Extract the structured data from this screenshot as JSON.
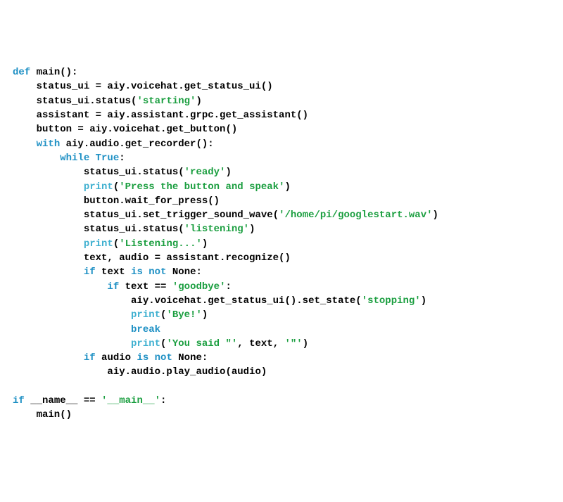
{
  "code": {
    "lines": [
      [
        {
          "t": "def ",
          "c": "kw"
        },
        {
          "t": "main():",
          "c": "plain"
        }
      ],
      [
        {
          "t": "    status_ui = aiy.voicehat.get_status_ui()",
          "c": "plain"
        }
      ],
      [
        {
          "t": "    status_ui.status(",
          "c": "plain"
        },
        {
          "t": "'starting'",
          "c": "str"
        },
        {
          "t": ")",
          "c": "plain"
        }
      ],
      [
        {
          "t": "    assistant = aiy.assistant.grpc.get_assistant()",
          "c": "plain"
        }
      ],
      [
        {
          "t": "    button = aiy.voicehat.get_button()",
          "c": "plain"
        }
      ],
      [
        {
          "t": "    ",
          "c": "plain"
        },
        {
          "t": "with",
          "c": "kw"
        },
        {
          "t": " aiy.audio.get_recorder():",
          "c": "plain"
        }
      ],
      [
        {
          "t": "        ",
          "c": "plain"
        },
        {
          "t": "while True",
          "c": "kw"
        },
        {
          "t": ":",
          "c": "plain"
        }
      ],
      [
        {
          "t": "            status_ui.status(",
          "c": "plain"
        },
        {
          "t": "'ready'",
          "c": "str"
        },
        {
          "t": ")",
          "c": "plain"
        }
      ],
      [
        {
          "t": "            ",
          "c": "plain"
        },
        {
          "t": "print",
          "c": "fn"
        },
        {
          "t": "(",
          "c": "plain"
        },
        {
          "t": "'Press the button and speak'",
          "c": "str"
        },
        {
          "t": ")",
          "c": "plain"
        }
      ],
      [
        {
          "t": "            button.wait_for_press()",
          "c": "plain"
        }
      ],
      [
        {
          "t": "            status_ui.set_trigger_sound_wave(",
          "c": "plain"
        },
        {
          "t": "'/home/pi/googlestart.wav'",
          "c": "str"
        },
        {
          "t": ")",
          "c": "plain"
        }
      ],
      [
        {
          "t": "            status_ui.status(",
          "c": "plain"
        },
        {
          "t": "'listening'",
          "c": "str"
        },
        {
          "t": ")",
          "c": "plain"
        }
      ],
      [
        {
          "t": "            ",
          "c": "plain"
        },
        {
          "t": "print",
          "c": "fn"
        },
        {
          "t": "(",
          "c": "plain"
        },
        {
          "t": "'Listening...'",
          "c": "str"
        },
        {
          "t": ")",
          "c": "plain"
        }
      ],
      [
        {
          "t": "            text, audio = assistant.recognize()",
          "c": "plain"
        }
      ],
      [
        {
          "t": "            ",
          "c": "plain"
        },
        {
          "t": "if",
          "c": "kw"
        },
        {
          "t": " text ",
          "c": "plain"
        },
        {
          "t": "is not",
          "c": "kw"
        },
        {
          "t": " None:",
          "c": "plain"
        }
      ],
      [
        {
          "t": "                ",
          "c": "plain"
        },
        {
          "t": "if",
          "c": "kw"
        },
        {
          "t": " text == ",
          "c": "plain"
        },
        {
          "t": "'goodbye'",
          "c": "str"
        },
        {
          "t": ":",
          "c": "plain"
        }
      ],
      [
        {
          "t": "                    aiy.voicehat.get_status_ui().set_state(",
          "c": "plain"
        },
        {
          "t": "'stopping'",
          "c": "str"
        },
        {
          "t": ")",
          "c": "plain"
        }
      ],
      [
        {
          "t": "                    ",
          "c": "plain"
        },
        {
          "t": "print",
          "c": "fn"
        },
        {
          "t": "(",
          "c": "plain"
        },
        {
          "t": "'Bye!'",
          "c": "str"
        },
        {
          "t": ")",
          "c": "plain"
        }
      ],
      [
        {
          "t": "                    ",
          "c": "plain"
        },
        {
          "t": "break",
          "c": "kw"
        }
      ],
      [
        {
          "t": "                    ",
          "c": "plain"
        },
        {
          "t": "print",
          "c": "fn"
        },
        {
          "t": "(",
          "c": "plain"
        },
        {
          "t": "'You said \"'",
          "c": "str"
        },
        {
          "t": ", text, ",
          "c": "plain"
        },
        {
          "t": "'\"'",
          "c": "str"
        },
        {
          "t": ")",
          "c": "plain"
        }
      ],
      [
        {
          "t": "            ",
          "c": "plain"
        },
        {
          "t": "if",
          "c": "kw"
        },
        {
          "t": " audio ",
          "c": "plain"
        },
        {
          "t": "is not",
          "c": "kw"
        },
        {
          "t": " None:",
          "c": "plain"
        }
      ],
      [
        {
          "t": "                aiy.audio.play_audio(audio)",
          "c": "plain"
        }
      ],
      [
        {
          "t": "",
          "c": "plain"
        }
      ],
      [
        {
          "t": "if",
          "c": "kw"
        },
        {
          "t": " __name__ == ",
          "c": "plain"
        },
        {
          "t": "'__main__'",
          "c": "str"
        },
        {
          "t": ":",
          "c": "plain"
        }
      ],
      [
        {
          "t": "    main()",
          "c": "plain"
        }
      ]
    ]
  }
}
